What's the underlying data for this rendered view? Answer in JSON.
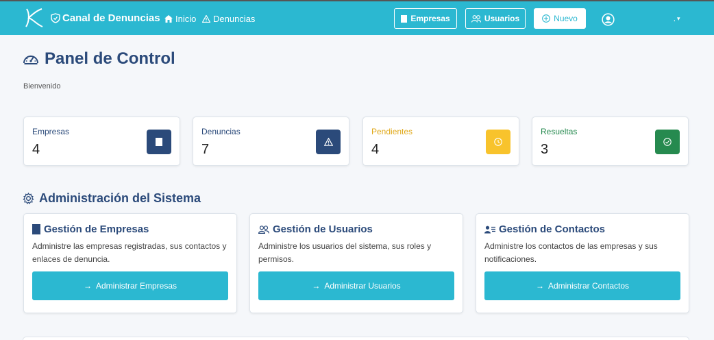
{
  "navbar": {
    "brand": "Canal de Denuncias",
    "links": [
      {
        "label": "Inicio",
        "icon": "home-icon"
      },
      {
        "label": "Denuncias",
        "icon": "warning-icon"
      }
    ],
    "buttons": {
      "empresas": "Empresas",
      "usuarios": "Usuarios",
      "nuevo": "Nuevo"
    },
    "user_caret": ","
  },
  "header": {
    "title": "Panel de Control",
    "welcome": "Bienvenido"
  },
  "stats": [
    {
      "label": "Empresas",
      "value": "4",
      "icon": "building-icon",
      "color": "#2b4a7a",
      "label_color": "#2b4a7a"
    },
    {
      "label": "Denuncias",
      "value": "7",
      "icon": "warning-icon",
      "color": "#2b4a7a",
      "label_color": "#2b4a7a"
    },
    {
      "label": "Pendientes",
      "value": "4",
      "icon": "clock-icon",
      "color": "#f8c32c",
      "label_color": "#e0a818"
    },
    {
      "label": "Resueltas",
      "value": "3",
      "icon": "check-circle-icon",
      "color": "#268a4f",
      "label_color": "#268a4f"
    }
  ],
  "admin": {
    "title": "Administración del Sistema",
    "cards": [
      {
        "title": "Gestión de Empresas",
        "description": "Administre las empresas registradas, sus contactos y enlaces de denuncia.",
        "button": "Administrar Empresas",
        "icon": "building-icon"
      },
      {
        "title": "Gestión de Usuarios",
        "description": "Administre los usuarios del sistema, sus roles y permisos.",
        "button": "Administrar Usuarios",
        "icon": "users-icon"
      },
      {
        "title": "Gestión de Contactos",
        "description": "Administre los contactos de las empresas y sus notificaciones.",
        "button": "Administrar Contactos",
        "icon": "contacts-icon"
      }
    ]
  },
  "colors": {
    "accent": "#2bb8d1",
    "primary_dark": "#2b4a7a"
  }
}
